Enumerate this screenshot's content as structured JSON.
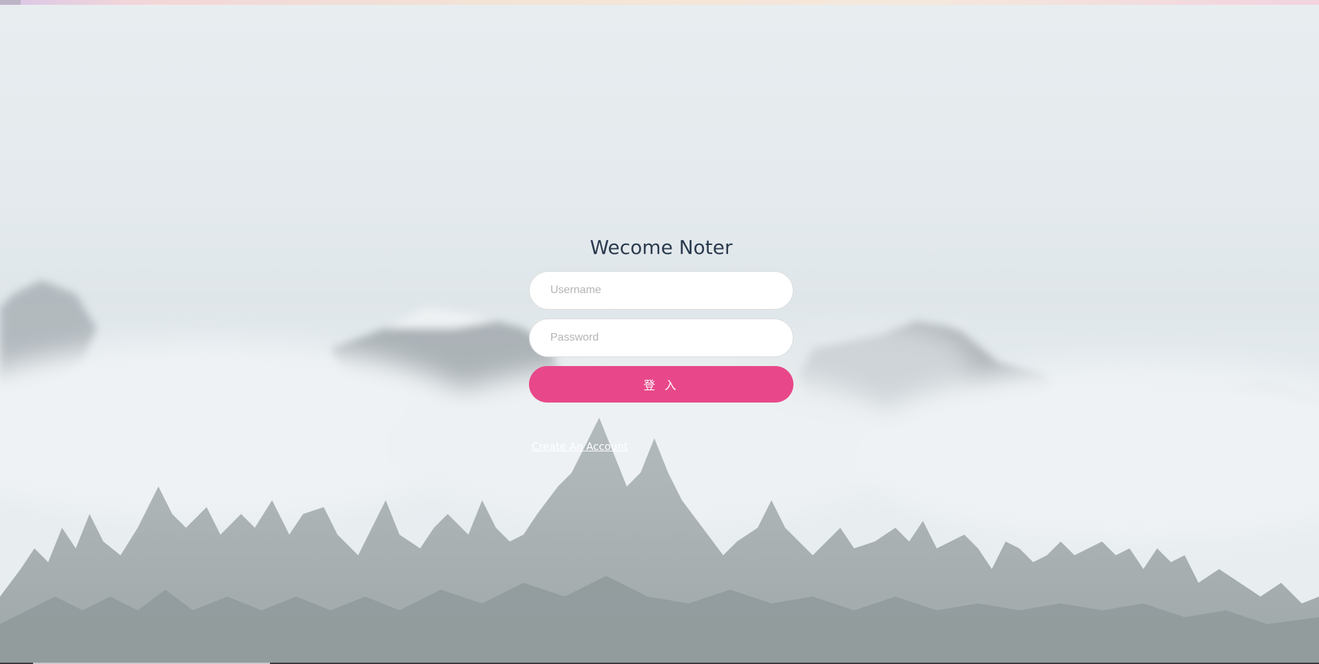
{
  "colors": {
    "accent": "#e8488a",
    "title": "#2b3a4e",
    "background_fog": "#e6ecef",
    "trees": "#9aa3a6"
  },
  "login": {
    "title": "Wecome Noter",
    "username_placeholder": "Username",
    "password_placeholder": "Password",
    "submit_label": "登 入",
    "create_account_label": "Create An Account"
  },
  "background": {
    "icons": [
      "mountain-icon",
      "tree-icon"
    ]
  }
}
